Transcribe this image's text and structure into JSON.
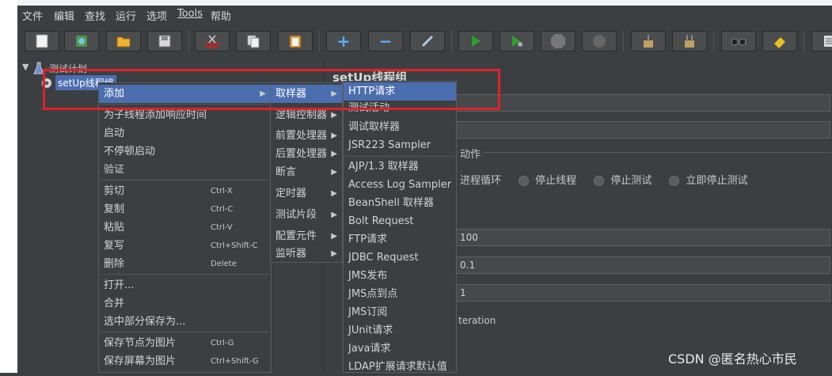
{
  "menubar": [
    "文件",
    "编辑",
    "查找",
    "运行",
    "选项",
    "Tools",
    "帮助"
  ],
  "tree": {
    "root": "测试计划",
    "child": "setUp线程组"
  },
  "right_panel": {
    "title": "setUp线程组",
    "action_label": "动作",
    "radios": [
      "进程循环",
      "停止线程",
      "停止测试",
      "立即停止测试"
    ],
    "field_values": [
      "100",
      "0.1",
      "1"
    ],
    "iteration_text": "teration"
  },
  "context_menu": {
    "items": [
      {
        "label": "添加",
        "shortcut": "",
        "submenu": true
      },
      {
        "label": "为子线程添加响应时间",
        "shortcut": ""
      },
      {
        "label": "启动",
        "shortcut": ""
      },
      {
        "label": "不停顿启动",
        "shortcut": ""
      },
      {
        "label": "验证",
        "shortcut": ""
      },
      {
        "label": "剪切",
        "shortcut": "Ctrl-X"
      },
      {
        "label": "复制",
        "shortcut": "Ctrl-C"
      },
      {
        "label": "粘贴",
        "shortcut": "Ctrl-V"
      },
      {
        "label": "复写",
        "shortcut": "Ctrl+Shift-C"
      },
      {
        "label": "删除",
        "shortcut": "Delete"
      },
      {
        "label": "打开...",
        "shortcut": ""
      },
      {
        "label": "合并",
        "shortcut": ""
      },
      {
        "label": "选中部分保存为...",
        "shortcut": ""
      },
      {
        "label": "保存节点为图片",
        "shortcut": "Ctrl-G"
      },
      {
        "label": "保存屏幕为图片",
        "shortcut": "Ctrl+Shift-G"
      }
    ]
  },
  "add_submenu": [
    "取样器",
    "逻辑控制器",
    "前置处理器",
    "后置处理器",
    "断言",
    "定时器",
    "测试片段",
    "配置元件",
    "监听器"
  ],
  "sampler_submenu": [
    "HTTP请求",
    "测试活动",
    "调试取样器",
    "JSR223 Sampler",
    "AJP/1.3 取样器",
    "Access Log Sampler",
    "BeanShell 取样器",
    "Bolt Request",
    "FTP请求",
    "JDBC Request",
    "JMS发布",
    "JMS点到点",
    "JMS订阅",
    "JUnit请求",
    "Java请求",
    "LDAP扩展请求默认值"
  ],
  "watermark": "CSDN @匿名热心市民",
  "colors": {
    "accent": "#4b6eaf",
    "highlight_box": "#e0202a",
    "background": "#3c3f41"
  }
}
